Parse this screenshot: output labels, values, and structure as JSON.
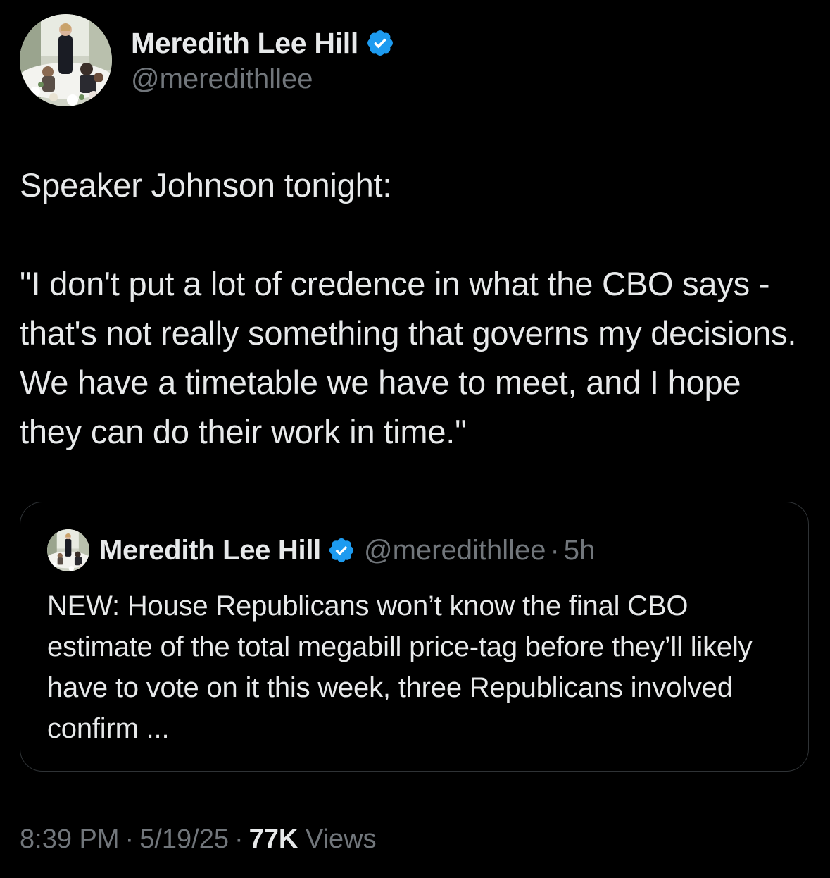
{
  "author": {
    "display_name": "Meredith Lee Hill",
    "handle": "@meredithllee",
    "verified": true,
    "verified_color": "#1d9bf0"
  },
  "tweet": {
    "lines": [
      "Speaker Johnson tonight:",
      "",
      "\"I don't put a lot of credence in what the CBO says - that's not really something that governs my decisions. We have a timetable we have to meet, and I hope they can do their work in time.\""
    ],
    "intro": "Speaker Johnson tonight:",
    "quote": "\"I don't put a lot of credence in what the CBO says - that's not really something that governs my decisions. We have a timetable we have to meet, and I hope they can do their work in time.\""
  },
  "quoted_tweet": {
    "display_name": "Meredith Lee Hill",
    "handle": "@meredithllee",
    "separator": "·",
    "age": "5h",
    "text": "NEW: House Republicans won’t know the final CBO estimate of the total megabill price-tag before they’ll likely have to vote on it this week, three Republicans involved confirm ..."
  },
  "meta": {
    "time": "8:39 PM",
    "date": "5/19/25",
    "separator": "·",
    "views_count": "77K",
    "views_label": "Views"
  },
  "colors": {
    "background": "#000000",
    "text_primary": "#e7e9ea",
    "text_secondary": "#71767b",
    "border": "#2f3336",
    "accent": "#1d9bf0"
  },
  "icons": {
    "verified_badge": "verified-badge-icon",
    "avatar": "profile-photo"
  }
}
